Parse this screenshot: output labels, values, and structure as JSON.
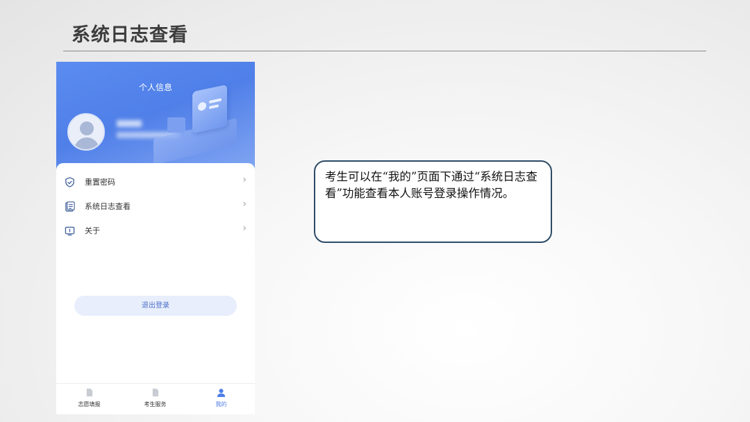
{
  "slide": {
    "title": "系统日志查看"
  },
  "phone": {
    "header_title": "个人信息",
    "menu": [
      {
        "label": "重置密码",
        "icon": "shield-check-icon"
      },
      {
        "label": "系统日志查看",
        "icon": "log-document-icon"
      },
      {
        "label": "关于",
        "icon": "info-screen-icon"
      }
    ],
    "arrow": "›",
    "logout_label": "退出登录",
    "tabs": [
      {
        "label": "志愿填报",
        "icon": "document-icon",
        "active": false
      },
      {
        "label": "考生服务",
        "icon": "document-icon",
        "active": false
      },
      {
        "label": "我的",
        "icon": "person-icon",
        "active": true
      }
    ]
  },
  "callout": {
    "text": "考生可以在“我的”页面下通过“系统日志查看”功能查看本人账号登录操作情况。"
  },
  "colors": {
    "accent": "#4f7fe8",
    "callout_border": "#2c4a66",
    "title_text": "#3c3c3c"
  }
}
